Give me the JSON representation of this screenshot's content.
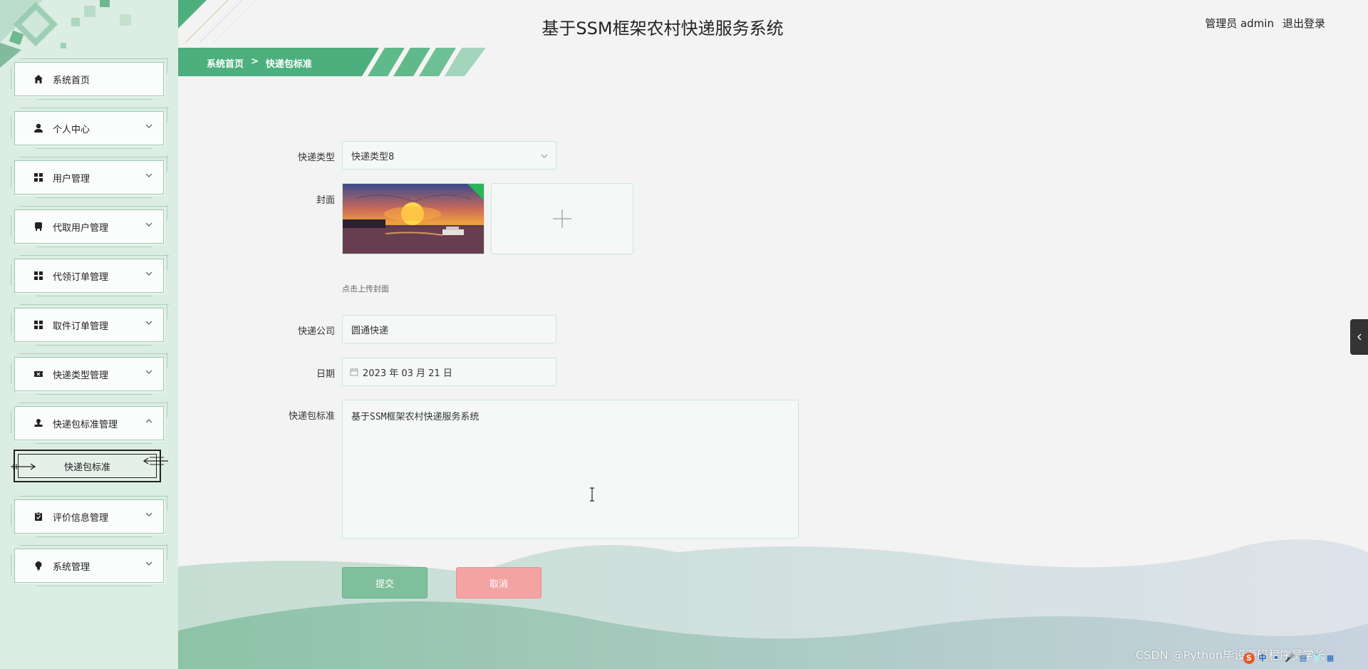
{
  "header": {
    "title": "基于SSM框架农村快递服务系统",
    "user_label": "管理员 admin",
    "logout_label": "退出登录"
  },
  "breadcrumb": {
    "home": "系统首页",
    "separator": ">",
    "current": "快递包标准"
  },
  "sidebar": {
    "items": [
      {
        "label": "系统首页",
        "icon": "home-icon"
      },
      {
        "label": "个人中心",
        "icon": "user-icon"
      },
      {
        "label": "用户管理",
        "icon": "grid-icon"
      },
      {
        "label": "代取用户管理",
        "icon": "badge-icon"
      },
      {
        "label": "代领订单管理",
        "icon": "grid-icon"
      },
      {
        "label": "取件订单管理",
        "icon": "grid-icon"
      },
      {
        "label": "快递类型管理",
        "icon": "ticket-icon"
      },
      {
        "label": "快递包标准管理",
        "icon": "stamp-icon"
      },
      {
        "label": "评价信息管理",
        "icon": "clipboard-icon"
      },
      {
        "label": "系统管理",
        "icon": "bulb-icon"
      }
    ],
    "submenu": {
      "label": "快递包标准"
    }
  },
  "form": {
    "type_label": "快递类型",
    "type_value": "快递类型8",
    "cover_label": "封面",
    "cover_hint": "点击上传封面",
    "company_label": "快递公司",
    "company_value": "圆通快递",
    "date_label": "日期",
    "date_value": "2023 年 03 月 21 日",
    "standard_label": "快递包标准",
    "standard_value": "基于SSM框架农村快递服务系统",
    "submit_label": "提交",
    "cancel_label": "取消"
  },
  "watermark": "CSDN @Python毕设源码程序员学长",
  "colors": {
    "accent": "#4caf7d",
    "sidebar_bg": "#dcede3",
    "cancel": "#f4a3a3",
    "submit": "#7fbf9c"
  }
}
